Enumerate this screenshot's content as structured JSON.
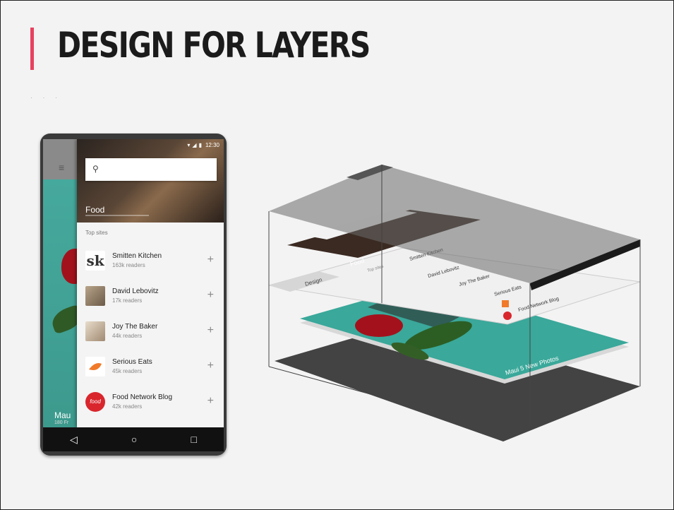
{
  "slide": {
    "title": "DESIGN FOR LAYERS",
    "dots": "· · ·"
  },
  "colors": {
    "accent": "#e8415f",
    "title": "#1b1b1b",
    "background": "#f3f3f3"
  },
  "phone": {
    "status_time": "12:30",
    "hero_label": "Food",
    "section_label": "Top sites",
    "background_caption": "Mau",
    "background_caption_sub": "180 Fr",
    "sites": [
      {
        "name": "Smitten Kitchen",
        "meta": "163k readers",
        "avatar_icon": "sk-logo-icon",
        "avatar_text": "sk"
      },
      {
        "name": "David Lebovitz",
        "meta": "17k readers",
        "avatar_icon": "portrait-icon"
      },
      {
        "name": "Joy The Baker",
        "meta": "44k readers",
        "avatar_icon": "portrait-icon"
      },
      {
        "name": "Serious Eats",
        "meta": "45k readers",
        "avatar_icon": "serious-eats-logo-icon"
      },
      {
        "name": "Food Network Blog",
        "meta": "42k readers",
        "avatar_icon": "food-network-logo-icon",
        "avatar_text": "food"
      }
    ],
    "nav": {
      "back": "◁",
      "home": "○",
      "recents": "□"
    }
  },
  "diagram": {
    "drawer_hero_label": "Food",
    "drawer_section_label": "Top sites",
    "toolbar_label": "Design",
    "sites": [
      "Smitten Kitchen",
      "David Lebovitz",
      "Joy The Baker",
      "Serious Eats",
      "Food Network Blog"
    ],
    "photo_caption": "Maui 5 New Photos"
  }
}
